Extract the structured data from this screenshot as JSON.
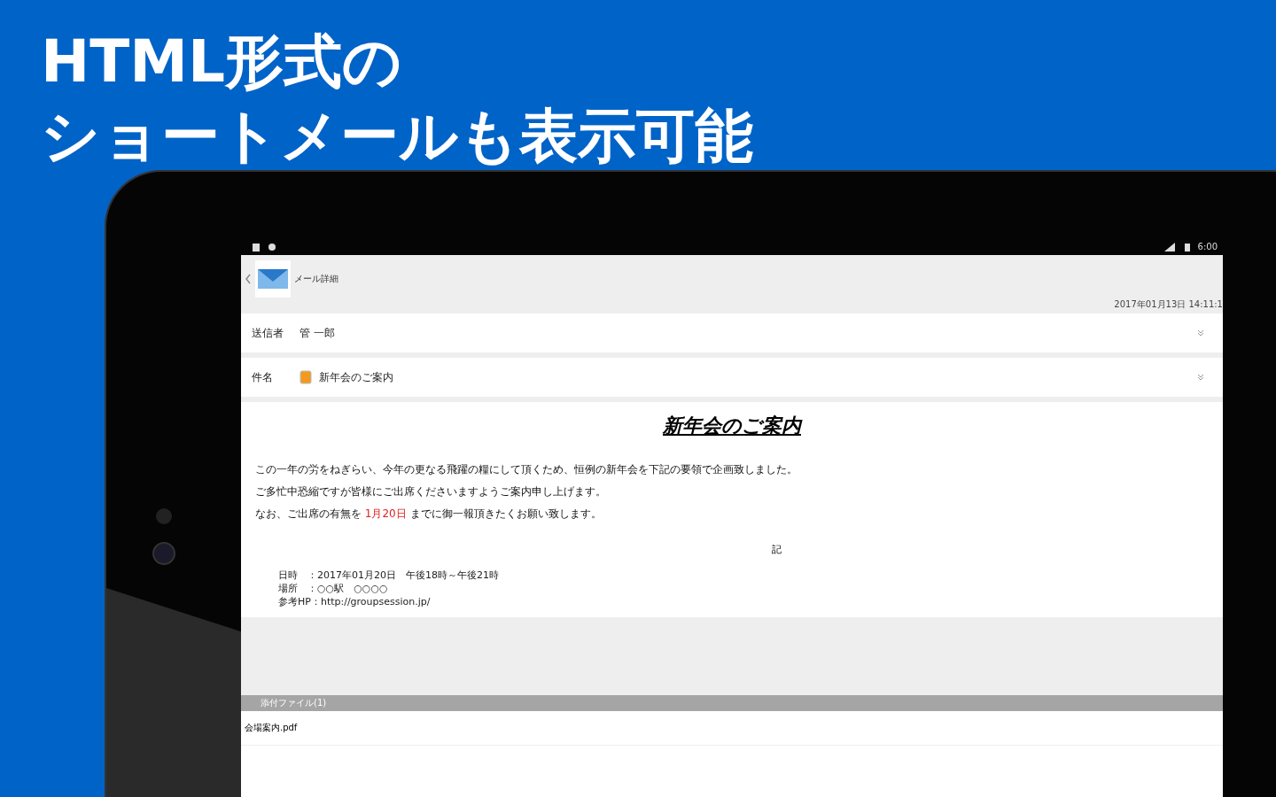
{
  "heading": {
    "lines": [
      "HTML形式の",
      "ショートメールも表示可能"
    ]
  },
  "status_bar": {
    "time": "6:00"
  },
  "header": {
    "title": "メール詳細",
    "date": "2017年01月13日 14:11:1"
  },
  "fields": [
    {
      "label": "送信者",
      "value": "管 一郎",
      "icon": false
    },
    {
      "label": "件名",
      "value": "新年会のご案内",
      "icon": true
    }
  ],
  "message": {
    "title": "新年会のご案内",
    "paragraphs": [
      [
        {
          "text": "この一年の労をねぎらい、今年の更なる飛躍の糧にして頂くため、恒例の新年会を下記の要領で企画致しました。",
          "highlight": false
        }
      ],
      [
        {
          "text": "ご多忙中恐縮ですが皆様にご出席くださいますようご案内申し上げます。",
          "highlight": false
        }
      ],
      [
        {
          "text": "なお、ご出席の有無を ",
          "highlight": false
        },
        {
          "text": "1月20日",
          "highlight": true
        },
        {
          "text": " までに御一報頂きたくお願い致します。",
          "highlight": false
        }
      ]
    ],
    "note": "記",
    "details": [
      "日時　：2017年01月20日　午後18時～午後21時",
      "場所　：○○駅　○○○○",
      "参考HP：http://groupsession.jp/"
    ]
  },
  "attachments": {
    "label": "添付ファイル(1)",
    "files": [
      "会場案内.pdf"
    ]
  }
}
